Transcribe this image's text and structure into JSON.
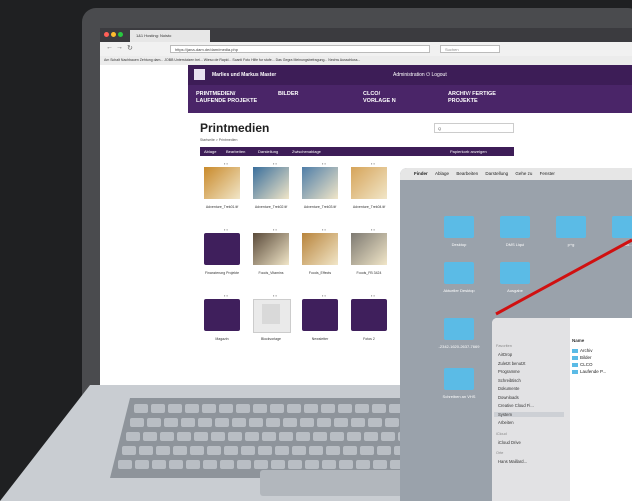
{
  "browser": {
    "tab_title": "1&1 Hosting: Noisto",
    "url": "https://jana-dam.de/dam/media.php",
    "search_placeholder": "Suchen",
    "bookmarks": "Am Schalt  Nachbauen  Zehtung dam...  JOBB  Unterstutzen bei...  Wieso de Rapid...  Scanti  Foto  Hilfe fur stufe...  Das Gegra  Meinungsbefragung...  Nechw Ausschluss..."
  },
  "site": {
    "user_label": "Marlies und Markus Master",
    "admin_label": "Administration",
    "logout_label": "Logout",
    "nav": [
      "PRINTMEDIEN/\nLAUFENDE PROJEKTE",
      "BILDER",
      "CLCO/\nVORLAGE N",
      "ARCHIV/ FERTIGE\nPROJEKTE"
    ],
    "page_title": "Printmedien",
    "breadcrumb": "Startseite > Printmedien",
    "search_label": "Q",
    "toolbar": [
      "Ablage",
      "Bearbeiten",
      "Darstellung",
      "Zwischenablage"
    ],
    "toolbar_right": "Papierkorb anzeigen",
    "tiles": [
      {
        "caption": "Adventure_Trek01.tif",
        "kind": "photo",
        "color": "#c98a2b"
      },
      {
        "caption": "Adventure_Trek02.tif",
        "kind": "photo",
        "color": "#3a6f9c"
      },
      {
        "caption": "Adventure_Trek03.tif",
        "kind": "photo",
        "color": "#4f7ea8"
      },
      {
        "caption": "Adventure_Trek04.tif",
        "kind": "photo",
        "color": "#d6a45a"
      },
      {
        "caption": "Finanzierung Projekte",
        "kind": "folder",
        "color": ""
      },
      {
        "caption": "Foods_Vitamins",
        "kind": "photo",
        "color": "#5a4a3a"
      },
      {
        "caption": "Foods_Effects",
        "kind": "photo",
        "color": "#b8843c"
      },
      {
        "caption": "Foods_FB 3424",
        "kind": "photo",
        "color": "#7e7a72"
      },
      {
        "caption": "Magazin",
        "kind": "folder",
        "color": ""
      },
      {
        "caption": "Blockvorlage",
        "kind": "doc",
        "color": "#d9d9d9"
      },
      {
        "caption": "Newsletter",
        "kind": "folder",
        "color": ""
      },
      {
        "caption": "Fotos 2",
        "kind": "folder",
        "color": ""
      }
    ]
  },
  "finder": {
    "menu": [
      "Finder",
      "Ablage",
      "Bearbeiten",
      "Darstellung",
      "Gehe zu",
      "Fenster"
    ],
    "desktop_items": [
      "Desktop",
      "DMS Liqui",
      "p+g",
      "Dan...",
      "Aktueller Desktop",
      "Ausgabe",
      "-2342-1620-2637-7669",
      "Schreiben an VHS"
    ],
    "sidebar_heading": "Favoriten",
    "sidebar_items": [
      "AirDrop",
      "Zuletzt benutzt",
      "Programme",
      "Schreibtisch",
      "Dokumente",
      "Downloads",
      "Creative Cloud Fi...",
      "System",
      "Arbeiten"
    ],
    "sidebar_heading2": "iCloud",
    "sidebar_items2": [
      "iCloud Drive"
    ],
    "sidebar_heading3": "Orte",
    "sidebar_items3": [
      "Hans Maillard..."
    ],
    "column_header": "Name",
    "rows": [
      "Archiv",
      "Bilder",
      "CLCO",
      "Laufende P..."
    ]
  },
  "colors": {
    "brand": "#3d1d57",
    "finder_folder": "#5bbbe6",
    "annotation_line": "#d01010"
  }
}
